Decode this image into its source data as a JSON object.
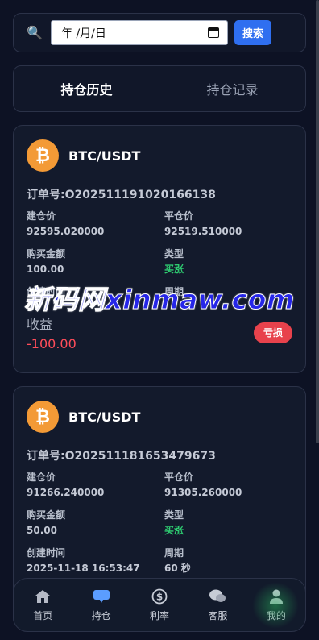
{
  "search": {
    "date_placeholder": "年 /月/日",
    "button_label": "搜索"
  },
  "tabs": [
    {
      "label": "持仓历史"
    },
    {
      "label": "持仓记录"
    }
  ],
  "orders": [
    {
      "pair": "BTC/USDT",
      "order_no": "订单号:O202511191020166138",
      "open_price_label": "建仓价",
      "open_price": "92595.020000",
      "close_price_label": "平仓价",
      "close_price": "92519.510000",
      "amount_label": "购买金额",
      "amount": "100.00",
      "type_label": "类型",
      "type": "买涨",
      "created_label": "创建时间",
      "period_label": "周期",
      "profit_label": "收益",
      "profit": "-100.00",
      "badge": "亏损"
    },
    {
      "pair": "BTC/USDT",
      "order_no": "订单号:O202511181653479673",
      "open_price_label": "建仓价",
      "open_price": "91266.240000",
      "close_price_label": "平仓价",
      "close_price": "91305.260000",
      "amount_label": "购买金额",
      "amount": "50.00",
      "type_label": "类型",
      "type": "买涨",
      "created_label": "创建时间",
      "created": "2025-11-18 16:53:47",
      "period_label": "周期",
      "period": "60 秒"
    }
  ],
  "watermark": "新码网xinmaw.com",
  "nav": [
    {
      "label": "首页",
      "icon": "home-icon"
    },
    {
      "label": "持仓",
      "icon": "chat-bubble-icon"
    },
    {
      "label": "利率",
      "icon": "dollar-icon"
    },
    {
      "label": "客服",
      "icon": "support-icon"
    },
    {
      "label": "我的",
      "icon": "user-icon"
    }
  ],
  "colors": {
    "accent": "#2f6ff0",
    "up": "#2ecc71",
    "loss": "#e8424c",
    "coin": "#f39a36"
  }
}
